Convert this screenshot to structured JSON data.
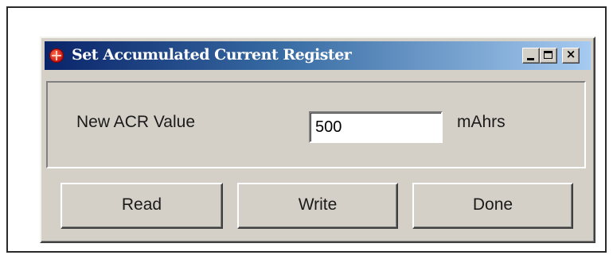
{
  "window": {
    "title": "Set Accumulated Current Register",
    "icon": "app-logo-icon",
    "controls": {
      "minimize_icon": "minimize-icon",
      "maximize_icon": "maximize-icon",
      "close_icon": "close-icon",
      "close_glyph": "×"
    }
  },
  "form": {
    "acr_label": "New ACR Value",
    "acr_value": "500",
    "unit": "mAhrs"
  },
  "buttons": {
    "read": "Read",
    "write": "Write",
    "done": "Done"
  },
  "colors": {
    "titlebar_start": "#0a246a",
    "titlebar_end": "#a6caf0",
    "face": "#d4d0c8",
    "icon_red": "#c41010"
  }
}
